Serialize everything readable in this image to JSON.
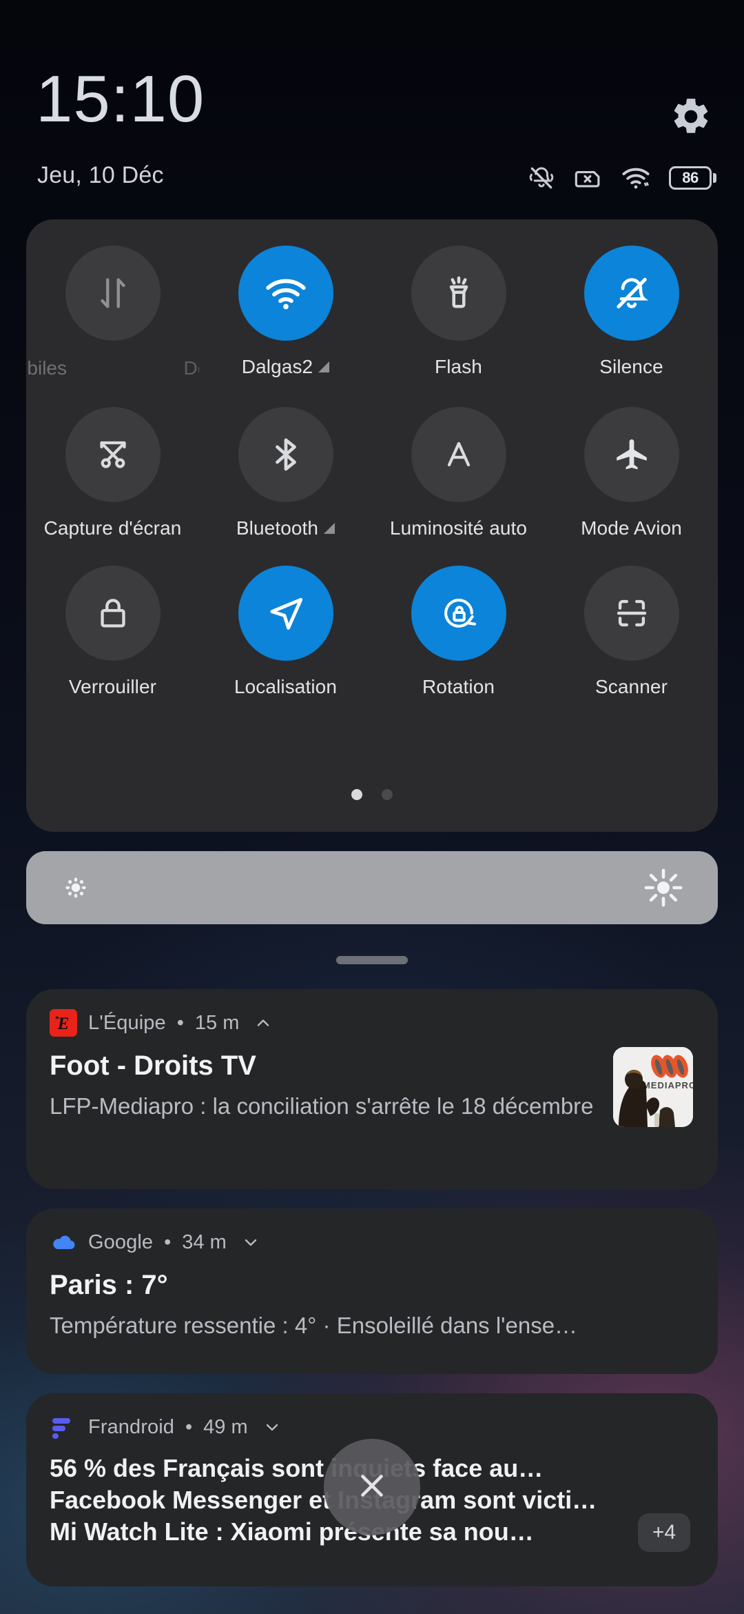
{
  "statusbar": {
    "time": "15:10",
    "date": "Jeu, 10 Déc",
    "settings_icon": "gear-icon",
    "icons": [
      "bell-muted-icon",
      "sim-card-missing-icon",
      "wifi-icon"
    ],
    "battery_percent": "86"
  },
  "quick_settings": {
    "tiles": [
      {
        "label": "Mobiles",
        "label_secondary": "Do",
        "icon": "data-transfer-icon",
        "active": false,
        "expandable": false
      },
      {
        "label": "Dalgas2",
        "icon": "wifi-icon",
        "active": true,
        "expandable": true
      },
      {
        "label": "Flash",
        "icon": "flashlight-icon",
        "active": false,
        "expandable": false
      },
      {
        "label": "Silence",
        "icon": "bell-muted-icon",
        "active": true,
        "expandable": false
      },
      {
        "label": "Capture d'écran",
        "icon": "scissors-screenshot-icon",
        "active": false,
        "expandable": false
      },
      {
        "label": "Bluetooth",
        "icon": "bluetooth-icon",
        "active": false,
        "expandable": true
      },
      {
        "label": "Luminosité auto",
        "icon": "auto-brightness-icon",
        "active": false,
        "expandable": false
      },
      {
        "label": "Mode Avion",
        "icon": "airplane-icon",
        "active": false,
        "expandable": false
      },
      {
        "label": "Verrouiller",
        "icon": "lock-icon",
        "active": false,
        "expandable": false
      },
      {
        "label": "Localisation",
        "icon": "location-arrow-icon",
        "active": true,
        "expandable": false
      },
      {
        "label": "Rotation",
        "icon": "rotation-unlock-icon",
        "active": true,
        "expandable": false
      },
      {
        "label": "Scanner",
        "icon": "qr-scanner-icon",
        "active": false,
        "expandable": false
      }
    ],
    "pages": 2,
    "current_page": 1,
    "accent_color": "#0b84d9",
    "tile_off_color": "#3c3c3e"
  },
  "brightness": {
    "low_icon": "brightness-low-icon",
    "high_icon": "brightness-high-icon",
    "level_percent": 100,
    "track_color": "#a3a5a9"
  },
  "notifications": [
    {
      "app": "L'Équipe",
      "separator": "•",
      "time": "15 m",
      "expand_state": "chevron-up-icon",
      "app_icon": "lequipe-icon",
      "title": "Foot - Droits TV",
      "body": "LFP-Mediapro : la conciliation s'arrête le 18 décembre",
      "thumbnail": "mediapro-logo-image",
      "thumbnail_text": "MEDIAPRO"
    },
    {
      "app": "Google",
      "separator": "•",
      "time": "34 m",
      "expand_state": "chevron-down-icon",
      "app_icon": "google-weather-cloud-icon",
      "title": "Paris : 7°",
      "body": "Température ressentie : 4° · Ensoleillé dans l'ense…"
    },
    {
      "app": "Frandroid",
      "separator": "•",
      "time": "49 m",
      "expand_state": "chevron-down-icon",
      "app_icon": "frandroid-icon",
      "lines": [
        "56 % des Français sont inquiets face au…",
        "Facebook Messenger et Instagram sont victi…",
        "Mi Watch Lite : Xiaomi présente sa nou…"
      ],
      "more_badge": "+4"
    }
  ],
  "clear_all": {
    "icon": "close-icon",
    "label": ""
  }
}
